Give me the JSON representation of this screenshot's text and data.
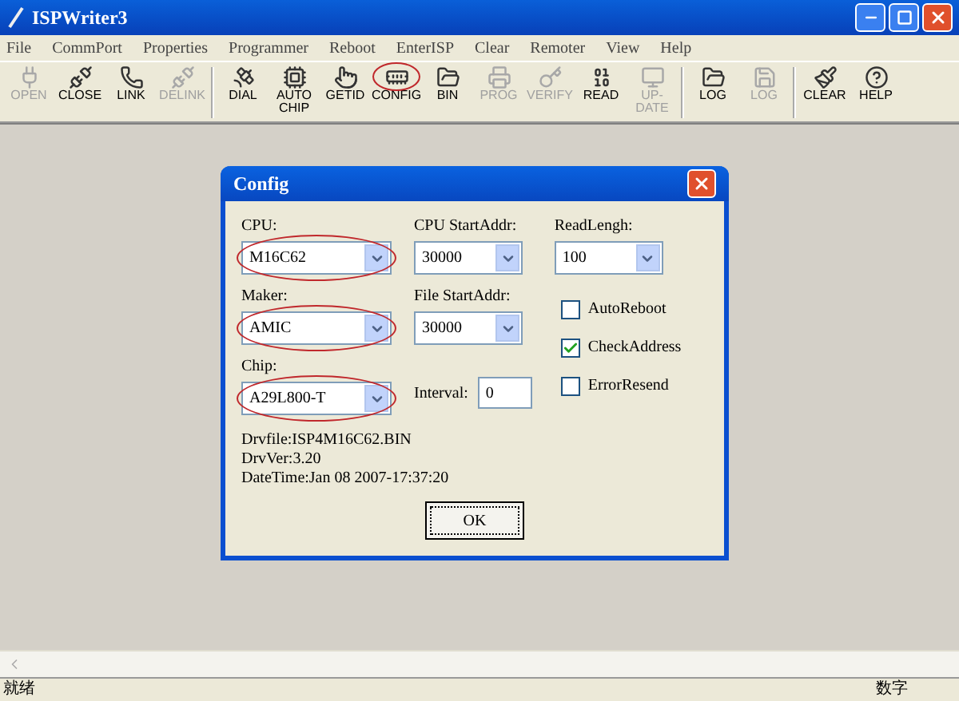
{
  "window": {
    "title": "ISPWriter3"
  },
  "menu": [
    "File",
    "CommPort",
    "Properties",
    "Programmer",
    "Reboot",
    "EnterISP",
    "Clear",
    "Remoter",
    "View",
    "Help"
  ],
  "toolbar": [
    {
      "kind": "button",
      "label": "OPEN",
      "disabled": true,
      "highlighted": false
    },
    {
      "kind": "button",
      "label": "CLOSE",
      "disabled": false,
      "highlighted": false
    },
    {
      "kind": "button",
      "label": "LINK",
      "disabled": false,
      "highlighted": false
    },
    {
      "kind": "button",
      "label": "DELINK",
      "disabled": true,
      "highlighted": false
    },
    {
      "kind": "separator"
    },
    {
      "kind": "button",
      "label": "DIAL",
      "disabled": false,
      "highlighted": false
    },
    {
      "kind": "button",
      "label": "AUTO CHIP",
      "disabled": false,
      "highlighted": false
    },
    {
      "kind": "button",
      "label": "GETID",
      "disabled": false,
      "highlighted": false
    },
    {
      "kind": "button",
      "label": "CONFIG",
      "disabled": false,
      "highlighted": true
    },
    {
      "kind": "button",
      "label": "BIN",
      "disabled": false,
      "highlighted": false
    },
    {
      "kind": "button",
      "label": "PROG",
      "disabled": true,
      "highlighted": false
    },
    {
      "kind": "button",
      "label": "VERIFY",
      "disabled": true,
      "highlighted": false
    },
    {
      "kind": "button",
      "label": "READ",
      "disabled": false,
      "highlighted": false
    },
    {
      "kind": "button",
      "label": "UP-DATE",
      "disabled": true,
      "highlighted": false
    },
    {
      "kind": "separator"
    },
    {
      "kind": "button",
      "label": "LOG",
      "disabled": false,
      "highlighted": false
    },
    {
      "kind": "button",
      "label": "LOG",
      "disabled": true,
      "highlighted": false
    },
    {
      "kind": "separator"
    },
    {
      "kind": "button",
      "label": "CLEAR",
      "disabled": false,
      "highlighted": false
    },
    {
      "kind": "button",
      "label": "HELP",
      "disabled": false,
      "highlighted": false
    }
  ],
  "dialog": {
    "title": "Config",
    "column_1": [
      {
        "label": "CPU:",
        "value": "M16C62",
        "highlighted": true
      },
      {
        "label": "Maker:",
        "value": "AMIC",
        "highlighted": true
      },
      {
        "label": "Chip:",
        "value": "A29L800-T",
        "highlighted": true
      }
    ],
    "column_2": [
      {
        "kind": "select",
        "label": "CPU StartAddr:",
        "value": "30000"
      },
      {
        "kind": "select",
        "label": "File StartAddr:",
        "value": "30000"
      },
      {
        "kind": "input",
        "label": "Interval:",
        "value": "0"
      }
    ],
    "column_3": {
      "label": "ReadLengh:",
      "value": "100",
      "options": [
        {
          "label": "AutoReboot",
          "checked": false
        },
        {
          "label": "CheckAddress",
          "checked": true
        },
        {
          "label": "ErrorResend",
          "checked": false
        }
      ]
    },
    "info": [
      "Drvfile:ISP4M16C62.BIN",
      "DrvVer:3.20",
      "DateTime:Jan 08 2007-17:37:20"
    ],
    "button": "OK"
  },
  "status_bar": [
    "就绪",
    "数字"
  ]
}
